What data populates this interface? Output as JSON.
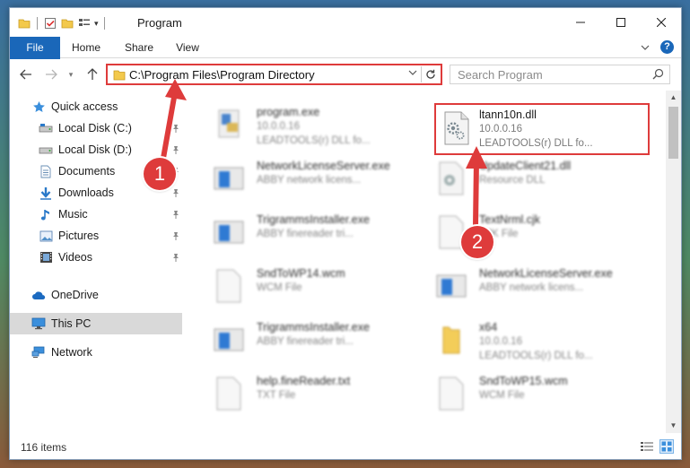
{
  "window": {
    "title": "Program"
  },
  "ribbon": {
    "tabs": [
      "File",
      "Home",
      "Share",
      "View"
    ]
  },
  "address": {
    "path": "C:\\Program Files\\Program Directory",
    "search_placeholder": "Search Program"
  },
  "sidebar": {
    "items": [
      {
        "label": "Quick access",
        "icon": "star-icon",
        "pinned": false
      },
      {
        "label": "Local Disk (C:)",
        "icon": "drive-icon",
        "pinned": true
      },
      {
        "label": "Local Disk (D:)",
        "icon": "drive-icon",
        "pinned": true
      },
      {
        "label": "Documents",
        "icon": "documents-icon",
        "pinned": true
      },
      {
        "label": "Downloads",
        "icon": "download-icon",
        "pinned": true
      },
      {
        "label": "Music",
        "icon": "music-icon",
        "pinned": true
      },
      {
        "label": "Pictures",
        "icon": "pictures-icon",
        "pinned": true
      },
      {
        "label": "Videos",
        "icon": "videos-icon",
        "pinned": true
      },
      {
        "label": "OneDrive",
        "icon": "cloud-icon",
        "pinned": false
      },
      {
        "label": "This PC",
        "icon": "computer-icon",
        "pinned": false,
        "selected": true
      },
      {
        "label": "Network",
        "icon": "network-icon",
        "pinned": false
      }
    ]
  },
  "files": [
    {
      "name": "program.exe",
      "line1": "10.0.0.16",
      "line2": "LEADTOOLS(r) DLL fo...",
      "icon": "exe-icon"
    },
    {
      "name": "ltann10n.dll",
      "line1": "10.0.0.16",
      "line2": "LEADTOOLS(r) DLL fo...",
      "icon": "dll-gear-icon",
      "highlighted": true
    },
    {
      "name": "NetworkLicenseServer.exe",
      "line1": "ABBY network licens...",
      "line2": "",
      "icon": "app-icon"
    },
    {
      "name": "UpdateClient21.dll",
      "line1": "Resource DLL",
      "line2": "",
      "icon": "dll-gear-icon"
    },
    {
      "name": "TrigrammsInstaller.exe",
      "line1": "ABBY finereader tri...",
      "line2": "",
      "icon": "app-icon"
    },
    {
      "name": "TextNrml.cjk",
      "line1": "CJK File",
      "line2": "",
      "icon": "blank-file-icon"
    },
    {
      "name": "SndToWP14.wcm",
      "line1": "WCM File",
      "line2": "",
      "icon": "blank-file-icon"
    },
    {
      "name": "NetworkLicenseServer.exe",
      "line1": "ABBY network licens...",
      "line2": "",
      "icon": "app-icon"
    },
    {
      "name": "TrigrammsInstaller.exe",
      "line1": "ABBY finereader tri...",
      "line2": "",
      "icon": "app-icon"
    },
    {
      "name": "x64",
      "line1": "10.0.0.16",
      "line2": "LEADTOOLS(r) DLL fo...",
      "icon": "folder-icon"
    },
    {
      "name": "help.fineReader.txt",
      "line1": "TXT File",
      "line2": "",
      "icon": "blank-file-icon"
    },
    {
      "name": "SndToWP15.wcm",
      "line1": "WCM File",
      "line2": "",
      "icon": "blank-file-icon"
    }
  ],
  "status": {
    "item_count": "116 items"
  },
  "annotations": {
    "step1": "1",
    "step2": "2"
  },
  "colors": {
    "accent": "#1a67b9",
    "highlight": "#de3b3b",
    "selected_nav": "#d9d9d9"
  }
}
